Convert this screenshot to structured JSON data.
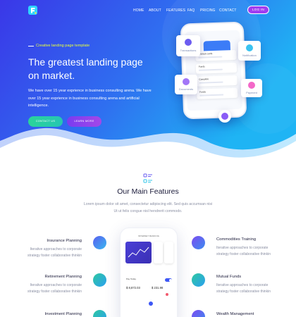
{
  "nav": {
    "items": [
      "HOME",
      "ABOUT",
      "FEATURES",
      "FAQ",
      "PRICING",
      "CONTACT"
    ],
    "login": "LOG IN"
  },
  "hero": {
    "tagline": "Creative landing page template",
    "headline_line1": "The greatest landing page",
    "headline_line2": "on market.",
    "description": "We have over 15 year exprience in business consulting arena. We have over 15 year exprience in business consulting arena and artificial intelligence.",
    "contact_button": "CONTACT US",
    "learn_button": "LEARN MORE",
    "phone_cards": [
      "Transactions",
      "Notification",
      "Documents",
      "Payment"
    ],
    "phone_rows": [
      "Unblock cards",
      "Funds",
      "Complete",
      "Funds"
    ]
  },
  "features": {
    "title": "Our Main Features",
    "subtitle": "Lorem ipsum dolor sit amet, consectetur adipiscing elit. Sed quis accumsan nisi Ut ut felis congue nisl hendrerit commodo.",
    "left": [
      {
        "title": "Insurance Planning",
        "text": "Iterative approaches to corporate strategy foster collaborative thinkin"
      },
      {
        "title": "Retirement Planning",
        "text": "Iterative approaches to corporate strategy foster collaborative thinkin"
      },
      {
        "title": "Investment Planning",
        "text": ""
      }
    ],
    "right": [
      {
        "title": "Commodities Training",
        "text": "Iterative approaches to corporate strategy foster collaborative thinkin"
      },
      {
        "title": "Mutual Funds",
        "text": "Iterative approaches to corporate strategy foster collaborative thinkin"
      },
      {
        "title": "Wealth Management",
        "text": ""
      }
    ],
    "phone": {
      "title": "INTERNET BANKING",
      "amount1": "$ 8,872.03",
      "amount2": "$ 231.98",
      "label": "Pay Today"
    }
  },
  "colors": {
    "hero_gradient_start": "#3a37e8",
    "hero_gradient_end": "#1fa8f2",
    "tagline": "#e8ff3a",
    "login_bg": "#a03cf0",
    "contact_btn": "#2ad39a",
    "learn_btn": "#8a42ec"
  }
}
